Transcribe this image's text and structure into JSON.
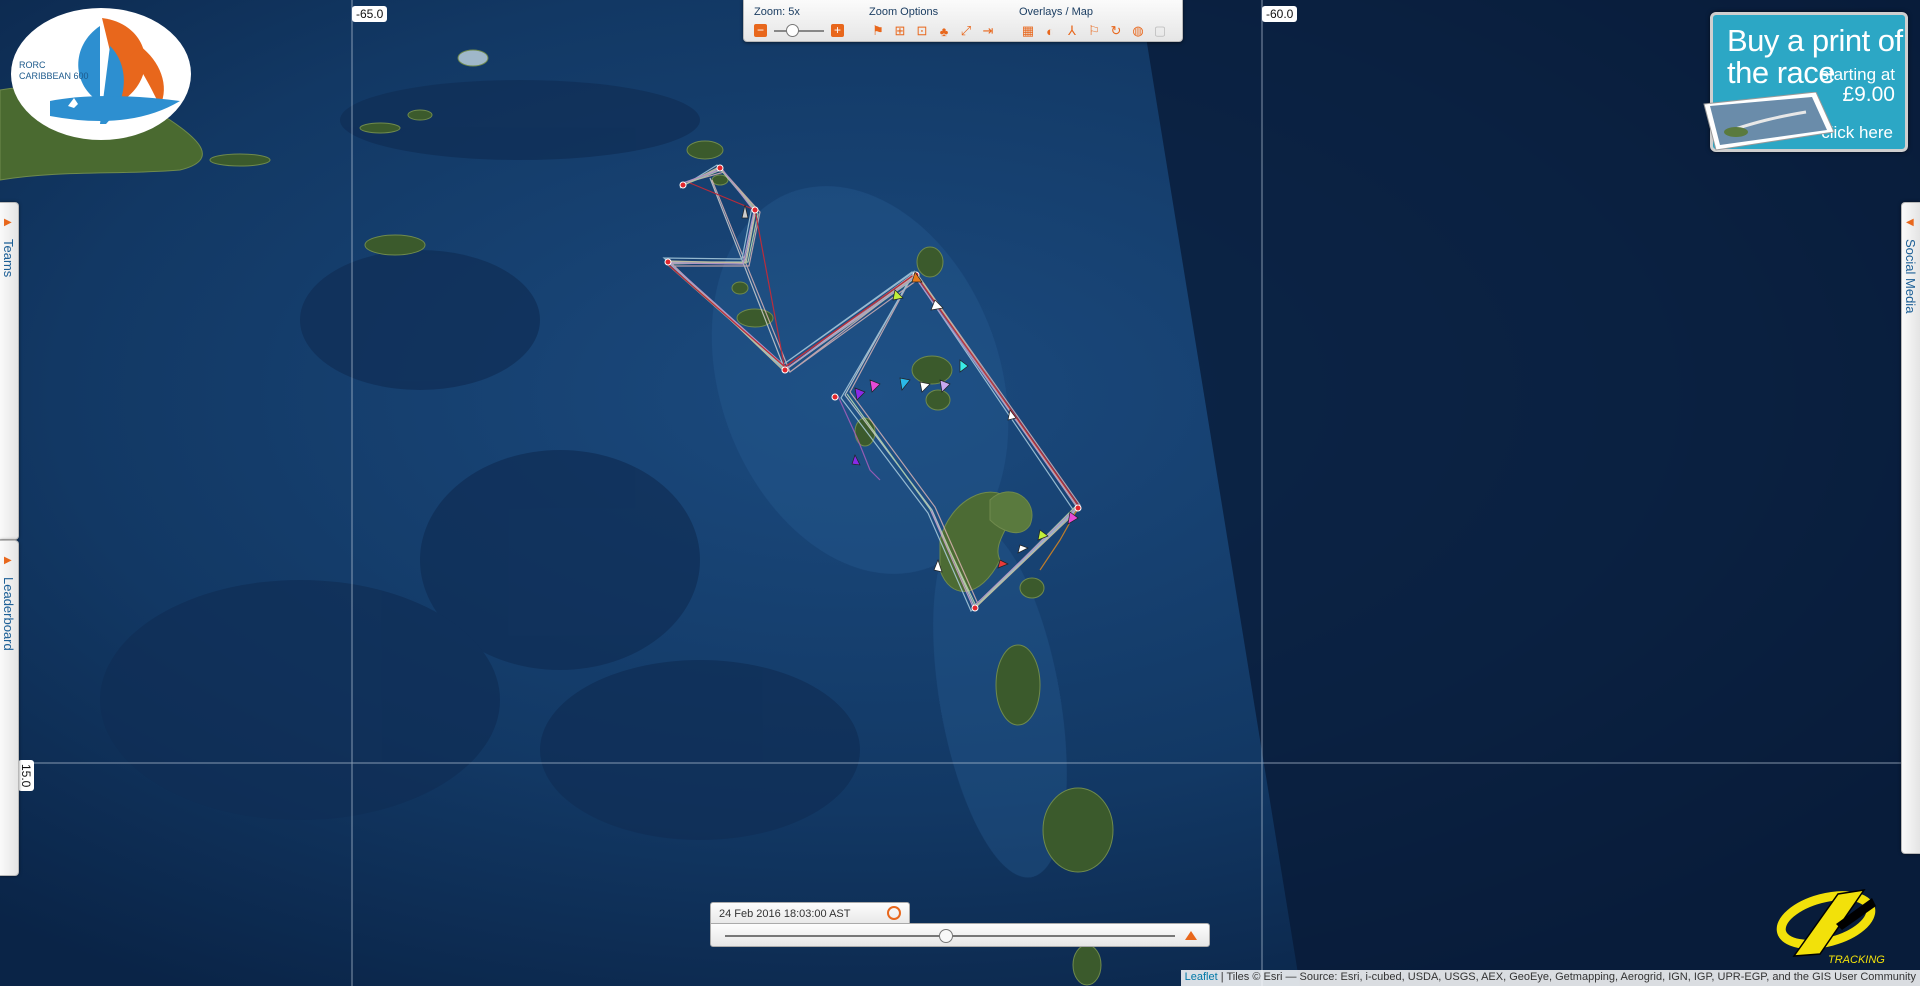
{
  "map": {
    "grid_labels": {
      "lon_left": "-65.0",
      "lon_right": "-60.0",
      "lat": "15.0"
    }
  },
  "logo": {
    "line1": "RORC",
    "line2": "CARIBBEAN 600"
  },
  "toolbar": {
    "zoom_title": "Zoom: 5x",
    "zoom_options_title": "Zoom Options",
    "overlays_title": "Overlays / Map",
    "zoom_icons": [
      "flag-icon",
      "zoom-in-box-icon",
      "zoom-fit-icon",
      "group-icon",
      "fullscreen-icon",
      "fit-width-icon"
    ],
    "overlay_icons": [
      "grid-icon",
      "contrast-icon",
      "wind-icon",
      "flags-icon",
      "rotate-icon",
      "globe-icon",
      "blank-icon"
    ]
  },
  "promo": {
    "line1": "Buy a print of",
    "line2": "the race",
    "starting_at": "starting at",
    "price": "£9.00",
    "click": "click here"
  },
  "tabs": {
    "teams": "Teams",
    "leaderboard": "Leaderboard",
    "social_media": "Social Media"
  },
  "time": {
    "label": "24 Feb 2016 18:03:00 AST",
    "position_fraction": 0.49
  },
  "brand": {
    "yb_text": "TRACKING"
  },
  "attribution": {
    "leaflet": "Leaflet",
    "text": " | Tiles © Esri — Source: Esri, i-cubed, USDA, USGS, AEX, GeoEye, Getmapping, Aerogrid, IGN, IGP, UPR-EGP, and the GIS User Community"
  },
  "colors": {
    "accent": "#e8671c",
    "ocean_deep": "#0b2145",
    "tab_text": "#1c5f96",
    "promo_bg": "#2ca7c5"
  }
}
